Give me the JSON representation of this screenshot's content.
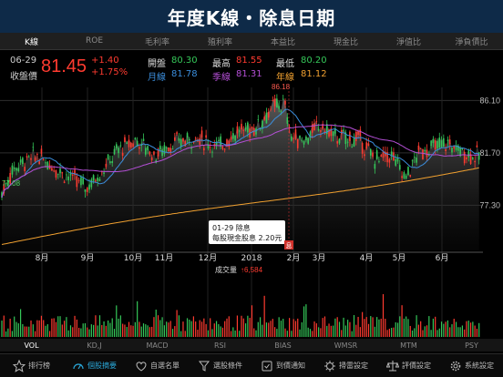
{
  "header": {
    "title": "年度K線・除息日期"
  },
  "tabs": [
    "K線",
    "ROE",
    "毛利率",
    "殖利率",
    "本益比",
    "現金比",
    "淨值比",
    "淨負債比"
  ],
  "quote": {
    "date": "06-29",
    "close_label": "收盤價",
    "price": "81.45",
    "change": "+1.40",
    "change_pct": "+1.75%",
    "open_label": "開盤",
    "open": "80.30",
    "high_label": "最高",
    "high": "81.55",
    "low_label": "最低",
    "low": "80.20",
    "ma_month_label": "月線",
    "ma_month": "81.78",
    "ma_season_label": "季線",
    "ma_season": "81.31",
    "ma_year_label": "年線",
    "ma_year": "81.12"
  },
  "colors": {
    "up": "#ff3b30",
    "down": "#35c759",
    "month": "#3b8ddb",
    "season": "#b44fd6",
    "year": "#f0a030"
  },
  "chart_data": {
    "type": "candlestick",
    "y_ticks": [
      "86.10",
      "81.70",
      "77.30"
    ],
    "x_labels": [
      "8月",
      "9月",
      "10月",
      "11月",
      "12月",
      "2018",
      "2月",
      "3月",
      "4月",
      "5月",
      "6月"
    ],
    "annotations": {
      "max": "86.18",
      "min": "77.08"
    },
    "tooltip": {
      "line1": "01-29 除息",
      "line2": "每股現金股息 2.20元",
      "marker": "息"
    },
    "volume_label": "成交量",
    "volume_value": "↑6,584"
  },
  "bottom_tabs": [
    "VOL",
    "KD,J",
    "MACD",
    "RSI",
    "BIAS",
    "WMSR",
    "MTM",
    "PSY"
  ],
  "nav": [
    {
      "label": "排行榜",
      "icon": "star-icon"
    },
    {
      "label": "個股摘要",
      "icon": "gauge-icon"
    },
    {
      "label": "自選名單",
      "icon": "heart-icon"
    },
    {
      "label": "選股條件",
      "icon": "filter-icon"
    },
    {
      "label": "到價通知",
      "icon": "bell-icon"
    },
    {
      "label": "掃雷設定",
      "icon": "mine-icon"
    },
    {
      "label": "評價設定",
      "icon": "scale-icon"
    },
    {
      "label": "系統設定",
      "icon": "gear-icon"
    }
  ]
}
